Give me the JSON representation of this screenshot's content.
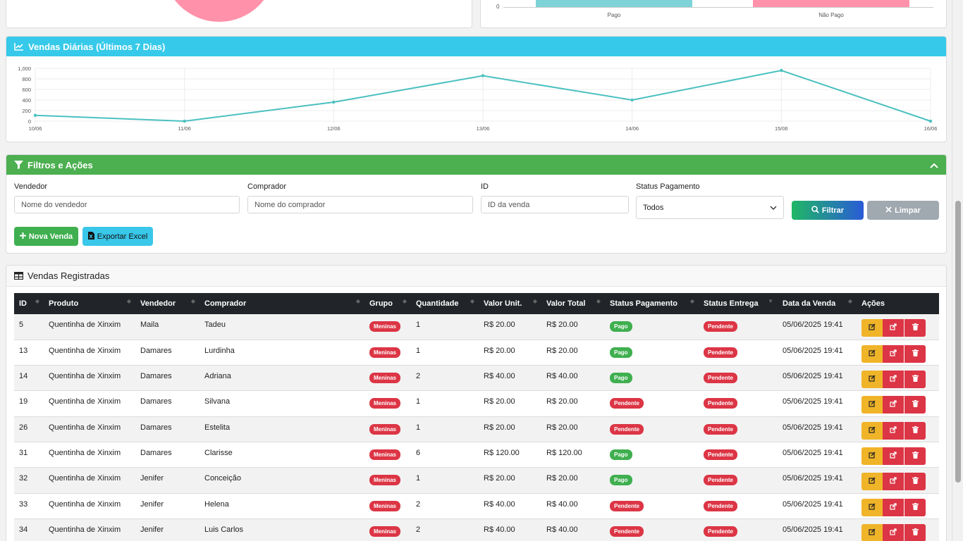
{
  "top_right_chart": {
    "y_tick": "0",
    "categories": [
      "Pago",
      "Não Pago"
    ],
    "colors": [
      "#7dd3d8",
      "#ff92aa"
    ]
  },
  "top_left_chart": {
    "pie_color": "#ff92aa"
  },
  "daily_chart": {
    "title": "Vendas Diárias (Últimos 7 Dias)",
    "icon": "line-chart-icon"
  },
  "chart_data": {
    "type": "line",
    "x": [
      "10/06",
      "11/06",
      "12/06",
      "13/06",
      "14/06",
      "15/06",
      "16/06"
    ],
    "series": [
      {
        "values": [
          110,
          0,
          360,
          860,
          400,
          960,
          0
        ],
        "color": "#4bc0c0"
      }
    ],
    "yticks": [
      "0",
      "200",
      "400",
      "600",
      "800",
      "1,000"
    ],
    "ylim": [
      0,
      1000
    ],
    "grid": true
  },
  "filters": {
    "title": "Filtros e Ações",
    "seller_label": "Vendedor",
    "seller_placeholder": "Nome do vendedor",
    "buyer_label": "Comprador",
    "buyer_placeholder": "Nome do comprador",
    "id_label": "ID",
    "id_placeholder": "ID da venda",
    "status_label": "Status Pagamento",
    "status_value": "Todos",
    "filter_button": "Filtrar",
    "clear_button": "Limpar",
    "new_sale_button": "Nova Venda",
    "export_button": "Exportar Excel"
  },
  "sales_table": {
    "title": "Vendas Registradas",
    "columns": [
      "ID",
      "Produto",
      "Vendedor",
      "Comprador",
      "Grupo",
      "Quantidade",
      "Valor Unit.",
      "Valor Total",
      "Status Pagamento",
      "Status Entrega",
      "Data da Venda",
      "Ações"
    ],
    "rows": [
      {
        "id": "5",
        "produto": "Quentinha de Xinxim",
        "vendedor": "Maila",
        "comprador": "Tadeu",
        "grupo": "Meninas",
        "quantidade": "1",
        "valor_unit": "R$ 20.00",
        "valor_total": "R$ 20.00",
        "status_pagamento": "Pago",
        "status_entrega": "Pendente",
        "data": "05/06/2025 19:41"
      },
      {
        "id": "13",
        "produto": "Quentinha de Xinxim",
        "vendedor": "Damares",
        "comprador": "Lurdinha",
        "grupo": "Meninas",
        "quantidade": "1",
        "valor_unit": "R$ 20.00",
        "valor_total": "R$ 20.00",
        "status_pagamento": "Pago",
        "status_entrega": "Pendente",
        "data": "05/06/2025 19:41"
      },
      {
        "id": "14",
        "produto": "Quentinha de Xinxim",
        "vendedor": "Damares",
        "comprador": "Adriana",
        "grupo": "Meninas",
        "quantidade": "2",
        "valor_unit": "R$ 40.00",
        "valor_total": "R$ 40.00",
        "status_pagamento": "Pago",
        "status_entrega": "Pendente",
        "data": "05/06/2025 19:41"
      },
      {
        "id": "19",
        "produto": "Quentinha de Xinxim",
        "vendedor": "Damares",
        "comprador": "Silvana",
        "grupo": "Meninas",
        "quantidade": "1",
        "valor_unit": "R$ 20.00",
        "valor_total": "R$ 20.00",
        "status_pagamento": "Pendente",
        "status_entrega": "Pendente",
        "data": "05/06/2025 19:41"
      },
      {
        "id": "26",
        "produto": "Quentinha de Xinxim",
        "vendedor": "Damares",
        "comprador": "Estelita",
        "grupo": "Meninas",
        "quantidade": "1",
        "valor_unit": "R$ 20.00",
        "valor_total": "R$ 20.00",
        "status_pagamento": "Pendente",
        "status_entrega": "Pendente",
        "data": "05/06/2025 19:41"
      },
      {
        "id": "31",
        "produto": "Quentinha de Xinxim",
        "vendedor": "Damares",
        "comprador": "Clarisse",
        "grupo": "Meninas",
        "quantidade": "6",
        "valor_unit": "R$ 120.00",
        "valor_total": "R$ 120.00",
        "status_pagamento": "Pago",
        "status_entrega": "Pendente",
        "data": "05/06/2025 19:41"
      },
      {
        "id": "32",
        "produto": "Quentinha de Xinxim",
        "vendedor": "Jenifer",
        "comprador": "Conceição",
        "grupo": "Meninas",
        "quantidade": "1",
        "valor_unit": "R$ 20.00",
        "valor_total": "R$ 20.00",
        "status_pagamento": "Pago",
        "status_entrega": "Pendente",
        "data": "05/06/2025 19:41"
      },
      {
        "id": "33",
        "produto": "Quentinha de Xinxim",
        "vendedor": "Jenifer",
        "comprador": "Helena",
        "grupo": "Meninas",
        "quantidade": "2",
        "valor_unit": "R$ 40.00",
        "valor_total": "R$ 40.00",
        "status_pagamento": "Pendente",
        "status_entrega": "Pendente",
        "data": "05/06/2025 19:41"
      },
      {
        "id": "34",
        "produto": "Quentinha de Xinxim",
        "vendedor": "Jenifer",
        "comprador": "Luis Carlos",
        "grupo": "Meninas",
        "quantidade": "2",
        "valor_unit": "R$ 40.00",
        "valor_total": "R$ 40.00",
        "status_pagamento": "Pendente",
        "status_entrega": "Pendente",
        "data": "05/06/2025 19:41"
      }
    ]
  },
  "colors": {
    "cyan": "#36c9ea",
    "green": "#4caf50",
    "red": "#dc3545",
    "yellow": "#f0b429",
    "dark": "#212529"
  }
}
